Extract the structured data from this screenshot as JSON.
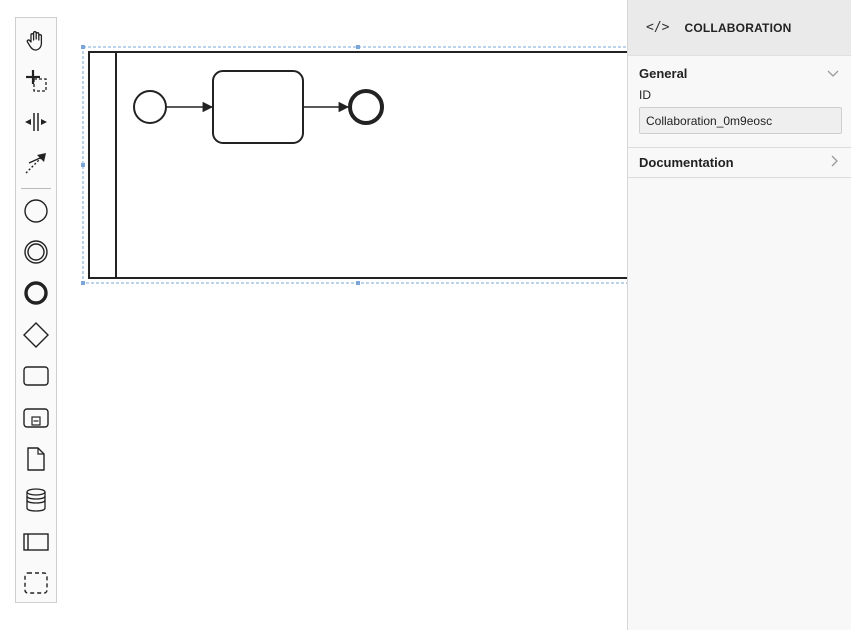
{
  "palette": {
    "tools": [
      {
        "name": "hand-tool-icon"
      },
      {
        "name": "lasso-tool-icon"
      },
      {
        "name": "space-tool-icon"
      },
      {
        "name": "global-connect-tool-icon"
      },
      {
        "name": "start-event-icon"
      },
      {
        "name": "intermediate-event-icon"
      },
      {
        "name": "end-event-icon"
      },
      {
        "name": "gateway-icon"
      },
      {
        "name": "task-icon"
      },
      {
        "name": "subprocess-icon"
      },
      {
        "name": "data-object-icon"
      },
      {
        "name": "data-store-icon"
      },
      {
        "name": "participant-pool-icon"
      },
      {
        "name": "group-icon"
      }
    ]
  },
  "properties_panel": {
    "header": {
      "icon_text": "</>",
      "element_type": "COLLABORATION"
    },
    "groups": [
      {
        "title": "General",
        "expanded": true,
        "fields": [
          {
            "label": "ID",
            "value": "Collaboration_0m9eosc"
          }
        ]
      },
      {
        "title": "Documentation",
        "expanded": false
      }
    ]
  },
  "colors": {
    "selection": "#7aa7d8",
    "stroke": "#222222",
    "panel_header_bg": "#eaeaea"
  }
}
